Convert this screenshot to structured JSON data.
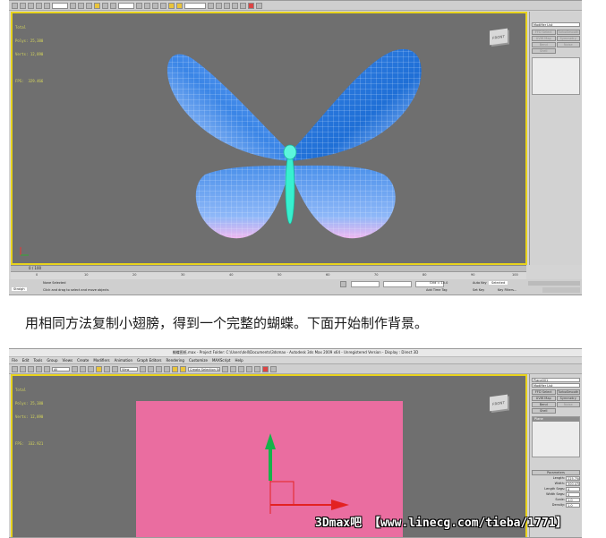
{
  "colors": {
    "viewport_bg": "#6f6f6f",
    "viewport_border": "#e8d31d",
    "wing_light": "#b7d2ff",
    "wing_dark": "#1f6fd6",
    "wing_pink": "#f0b8f0",
    "body_cyan": "#37f0cf",
    "plane_pink": "#ea6da0",
    "gizmo_green": "#15b34a",
    "gizmo_red": "#e32222"
  },
  "top_shot": {
    "stats": [
      "Total",
      "Polys: 25,380",
      "Verts: 12,890",
      "",
      "FPS:  329.466"
    ],
    "navcube_label": "FRONT",
    "panel": {
      "modifier_list": "Modifier List",
      "buttons": [
        {
          "label": "FFD Select",
          "icon": "ffd-select-icon",
          "disabled": true
        },
        {
          "label": "TurboSmooth",
          "icon": "turbosmooth-icon",
          "disabled": true
        },
        {
          "label": "UVW Map",
          "icon": "uvw-map-icon",
          "disabled": true
        },
        {
          "label": "Symmetry",
          "icon": "symmetry-icon",
          "disabled": true
        },
        {
          "label": "Bend",
          "icon": "bend-icon",
          "disabled": true
        },
        {
          "label": "Noise",
          "icon": "noise-icon",
          "disabled": true
        },
        {
          "label": "Shell",
          "icon": "shell-icon",
          "disabled": true
        }
      ]
    },
    "timeline": {
      "frame_label": "0 / 100",
      "ticks": [
        "0",
        "10",
        "20",
        "30",
        "40",
        "50",
        "60",
        "70",
        "80",
        "90",
        "100"
      ]
    },
    "status": {
      "selection": "None Selected",
      "hint": "Click and drag to select and move objects",
      "mode": "Straigh",
      "grid": "Grid = 10.0",
      "auto_key": "Auto Key",
      "selected": "Selected",
      "set_key": "Set Key",
      "key_filters": "Key Filters...",
      "add_time_tag": "Add Time Tag"
    }
  },
  "caption": "用相同方法复制小翅膀，得到一个完整的蝴蝶。下面开始制作背景。",
  "bottom_shot": {
    "title": "蝴蝶图纸.max   - Project Folder: C:\\Users\\dell\\Documents\\3dsmax   - Autodesk 3ds Max  2009 x64   - Unregistered Version   - Display : Direct 3D",
    "menu": [
      "File",
      "Edit",
      "Tools",
      "Group",
      "Views",
      "Create",
      "Modifiers",
      "Animation",
      "Graph Editors",
      "Rendering",
      "Customize",
      "MAXScript",
      "Help"
    ],
    "toolbar_fields": {
      "filter": "All",
      "view": "View",
      "selection_set": "Create Selection Set"
    },
    "stats": [
      "Total",
      "Polys: 25,380",
      "Verts: 12,890",
      "",
      "FPS:  332.921"
    ],
    "navcube_label": "FRONT",
    "panel": {
      "object_name": "Plane001",
      "modifier_list": "Modifier List",
      "buttons": [
        {
          "label": "FFD Select",
          "icon": "ffd-select-icon",
          "disabled": false
        },
        {
          "label": "TurboSmooth",
          "icon": "turbosmooth-icon",
          "disabled": false
        },
        {
          "label": "UVW Map",
          "icon": "uvw-map-icon",
          "disabled": false
        },
        {
          "label": "Symmetry",
          "icon": "symmetry-icon",
          "disabled": false
        },
        {
          "label": "Bend",
          "icon": "bend-icon",
          "disabled": false
        },
        {
          "label": "Noise",
          "icon": "noise-icon",
          "disabled": true
        },
        {
          "label": "Shell",
          "icon": "shell-icon",
          "disabled": false
        }
      ],
      "stack_item": "Plane",
      "params_title": "Parameters",
      "params": [
        {
          "label": "Length:",
          "value": "225.758"
        },
        {
          "label": "Width:",
          "value": "300.478"
        },
        {
          "label": "Length Segs:",
          "value": "4"
        },
        {
          "label": "Width Segs:",
          "value": "4"
        },
        {
          "label": "Scale:",
          "value": "1.0"
        },
        {
          "label": "Density:",
          "value": "1.0"
        }
      ]
    }
  },
  "watermark": "3Dmax吧 【www.linecg.com/tieba/1771】"
}
